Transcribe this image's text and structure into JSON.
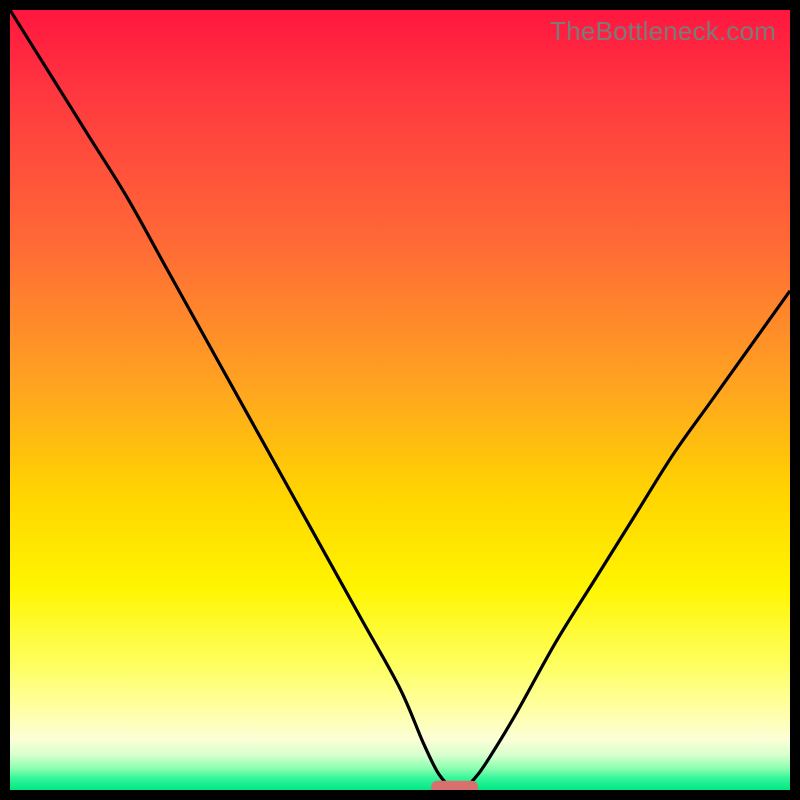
{
  "watermark": "TheBottleneck.com",
  "chart_data": {
    "type": "line",
    "title": "",
    "xlabel": "",
    "ylabel": "",
    "xlim": [
      0,
      100
    ],
    "ylim": [
      0,
      100
    ],
    "grid": false,
    "legend": false,
    "series": [
      {
        "name": "bottleneck-curve",
        "x": [
          0,
          5,
          10,
          15,
          20,
          25,
          30,
          35,
          40,
          45,
          50,
          53,
          55,
          57,
          58,
          60,
          62,
          65,
          70,
          75,
          80,
          85,
          90,
          95,
          100
        ],
        "y": [
          100,
          92,
          84,
          76,
          67,
          58,
          49,
          40,
          31,
          22,
          13,
          6,
          2,
          0,
          0,
          2,
          5,
          10,
          19,
          27,
          35,
          43,
          50,
          57,
          64
        ]
      }
    ],
    "marker": {
      "name": "sweet-spot",
      "x": 57,
      "y": 0,
      "width": 6,
      "height": 2,
      "color": "#d8706e"
    },
    "gradient_stops": [
      {
        "offset": 0.0,
        "color": "#ff163f"
      },
      {
        "offset": 0.12,
        "color": "#ff3b3f"
      },
      {
        "offset": 0.3,
        "color": "#ff6a36"
      },
      {
        "offset": 0.48,
        "color": "#ffa321"
      },
      {
        "offset": 0.62,
        "color": "#ffd400"
      },
      {
        "offset": 0.74,
        "color": "#fff500"
      },
      {
        "offset": 0.84,
        "color": "#feff60"
      },
      {
        "offset": 0.9,
        "color": "#ffffa8"
      },
      {
        "offset": 0.935,
        "color": "#fbffd6"
      },
      {
        "offset": 0.955,
        "color": "#d8ffce"
      },
      {
        "offset": 0.972,
        "color": "#8dffb0"
      },
      {
        "offset": 0.985,
        "color": "#34f59a"
      },
      {
        "offset": 1.0,
        "color": "#00e884"
      }
    ]
  }
}
